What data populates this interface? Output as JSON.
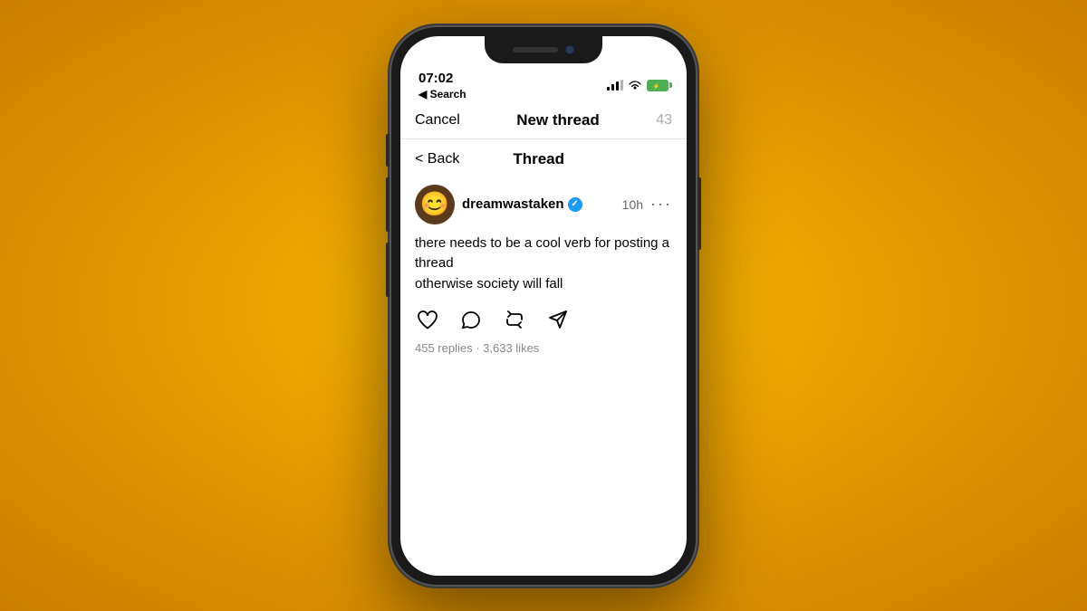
{
  "background": {
    "gradient_start": "#f5b800",
    "gradient_end": "#c97e00"
  },
  "phone": {
    "status_bar": {
      "time": "07:02",
      "search_label": "◀ Search",
      "battery_color": "#4caf50"
    },
    "top_nav": {
      "cancel_label": "Cancel",
      "title": "New thread",
      "char_count": "43"
    },
    "secondary_nav": {
      "back_label": "< Back",
      "title": "Thread"
    },
    "post": {
      "username": "dreamwastaken",
      "verified": true,
      "time_ago": "10h",
      "content_line1": "there needs to be a cool verb for posting a thread",
      "content_line2": "otherwise society will fall",
      "stats": "455 replies · 3,633 likes"
    }
  }
}
